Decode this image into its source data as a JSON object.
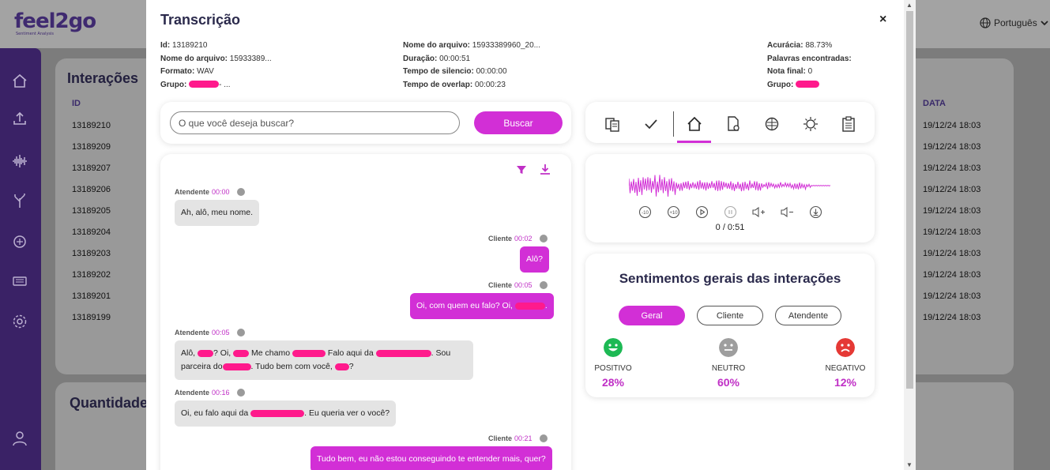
{
  "background": {
    "logo_text": "feel2go",
    "logo_tagline": "Sentiment Analysis",
    "language": "Português",
    "interacoes_title": "Interações",
    "quantidade_title": "Quantidade",
    "col_id": "ID",
    "col_data": "DATA",
    "rows": [
      {
        "id": "13189210",
        "date": "19/12/24 18:03"
      },
      {
        "id": "13189209",
        "date": "19/12/24 18:03"
      },
      {
        "id": "13189207",
        "date": "19/12/24 18:03"
      },
      {
        "id": "13189206",
        "date": "19/12/24 18:03"
      },
      {
        "id": "13189205",
        "date": "19/12/24 18:03"
      },
      {
        "id": "13189204",
        "date": "19/12/24 18:03"
      },
      {
        "id": "13189203",
        "date": "19/12/24 18:03"
      },
      {
        "id": "13189202",
        "date": "19/12/24 18:03"
      },
      {
        "id": "13189201",
        "date": "19/12/24 18:03"
      },
      {
        "id": "13189199",
        "date": "19/12/24 18:03"
      }
    ]
  },
  "modal": {
    "title": "Transcrição",
    "close": "×",
    "meta_col1": {
      "id_label": "Id:",
      "id_value": "13189210",
      "file_label": "Nome do arquivo:",
      "file_value": "15933389...",
      "format_label": "Formato:",
      "format_value": "WAV",
      "group_label": "Grupo:",
      "group_suffix": "- ..."
    },
    "meta_col2": {
      "file_label": "Nome do arquivo:",
      "file_value": "15933389960_20...",
      "duration_label": "Duração:",
      "duration_value": "00:00:51",
      "silence_label": "Tempo de silencio:",
      "silence_value": "00:00:00",
      "overlap_label": "Tempo de overlap:",
      "overlap_value": "00:00:23"
    },
    "meta_col3": {
      "accuracy_label": "Acurácia:",
      "accuracy_value": "88.73%",
      "words_label": "Palavras encontradas:",
      "words_value": "",
      "score_label": "Nota final:",
      "score_value": "0",
      "group_label": "Grupo:"
    },
    "search": {
      "placeholder": "O que você deseja buscar?",
      "button": "Buscar"
    },
    "messages": [
      {
        "speaker": "Atendente",
        "time": "00:00",
        "text": "Ah, alô, meu nome."
      },
      {
        "speaker": "Cliente",
        "time": "00:02",
        "text": "Alô?"
      },
      {
        "speaker": "Cliente",
        "time": "00:05",
        "text_a": "Oi, com quem eu falo? Oi,",
        "text_b": "."
      },
      {
        "speaker": "Atendente",
        "time": "00:05",
        "p1": "Alô,",
        "p2": "? Oi,",
        "p3": "Me chamo",
        "p4": "Falo aqui da",
        "p5": ". Sou",
        "p6": "parceira do",
        "p7": ". Tudo bem com você,",
        "p8": "?"
      },
      {
        "speaker": "Atendente",
        "time": "00:16",
        "text_a": "Oi, eu falo aqui da",
        "text_b": ". Eu queria ver o você?"
      },
      {
        "speaker": "Cliente",
        "time": "00:21",
        "text": "Tudo bem, eu não estou conseguindo te entender mais, quer?"
      }
    ],
    "player": {
      "time": "0 / 0:51"
    },
    "sentiment": {
      "title": "Sentimentos gerais das interações",
      "tabs": [
        "Geral",
        "Cliente",
        "Atendente"
      ],
      "positive_label": "POSITIVO",
      "positive_value": "28%",
      "neutral_label": "NEUTRO",
      "neutral_value": "60%",
      "negative_label": "NEGATIVO",
      "negative_value": "12%",
      "colors": {
        "positive": "#1db954",
        "neutral": "#9e9e9e",
        "negative": "#e53935",
        "accent": "#d22fd6"
      }
    }
  }
}
